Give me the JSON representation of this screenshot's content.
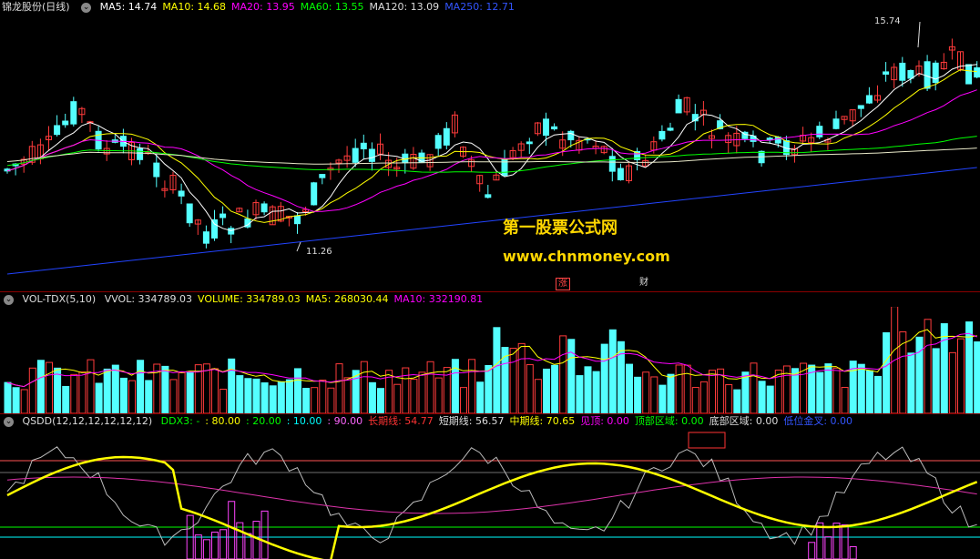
{
  "header": {
    "stock": "锦龙股份(日线)",
    "ma": [
      {
        "label": "MA5: 14.74",
        "color": "#ffffff"
      },
      {
        "label": "MA10: 14.68",
        "color": "#ffff00"
      },
      {
        "label": "MA20: 13.95",
        "color": "#ff00ff"
      },
      {
        "label": "MA60: 13.55",
        "color": "#00ff00"
      },
      {
        "label": "MA120: 13.09",
        "color": "#dddddd"
      },
      {
        "label": "MA250: 12.71",
        "color": "#3355ff"
      }
    ]
  },
  "price": {
    "high_label": "15.74",
    "low_label": "11.26",
    "watermark_title": "第一股票公式网",
    "watermark_url": "www.chnmoney.com",
    "tag1": "涨",
    "tag2": "财"
  },
  "volume_header": {
    "name": "VOL-TDX(5,10)",
    "items": [
      {
        "label": "VVOL: 334789.03",
        "color": "#dddddd"
      },
      {
        "label": "VOLUME: 334789.03",
        "color": "#ffff00"
      },
      {
        "label": "MA5: 268030.44",
        "color": "#ffff00"
      },
      {
        "label": "MA10: 332190.81",
        "color": "#ff00ff"
      }
    ]
  },
  "qsdd_header": {
    "name": "QSDD(12,12,12,12,12,12)",
    "items": [
      {
        "label": "DDX3: -",
        "color": "#00ff00"
      },
      {
        "label": ": 80.00",
        "color": "#ffff00"
      },
      {
        "label": ": 20.00",
        "color": "#00ff00"
      },
      {
        "label": ": 10.00",
        "color": "#00ffff"
      },
      {
        "label": ": 90.00",
        "color": "#ff66ff"
      },
      {
        "label": "长期线: 54.77",
        "color": "#ff3333"
      },
      {
        "label": "短期线: 56.57",
        "color": "#dddddd"
      },
      {
        "label": "中期线: 70.65",
        "color": "#ffff00"
      },
      {
        "label": "见顶: 0.00",
        "color": "#ff00ff"
      },
      {
        "label": "顶部区域: 0.00",
        "color": "#00ff00"
      },
      {
        "label": "底部区域: 0.00",
        "color": "#dddddd"
      },
      {
        "label": "低位金叉: 0.00",
        "color": "#3355ff"
      }
    ]
  }
}
